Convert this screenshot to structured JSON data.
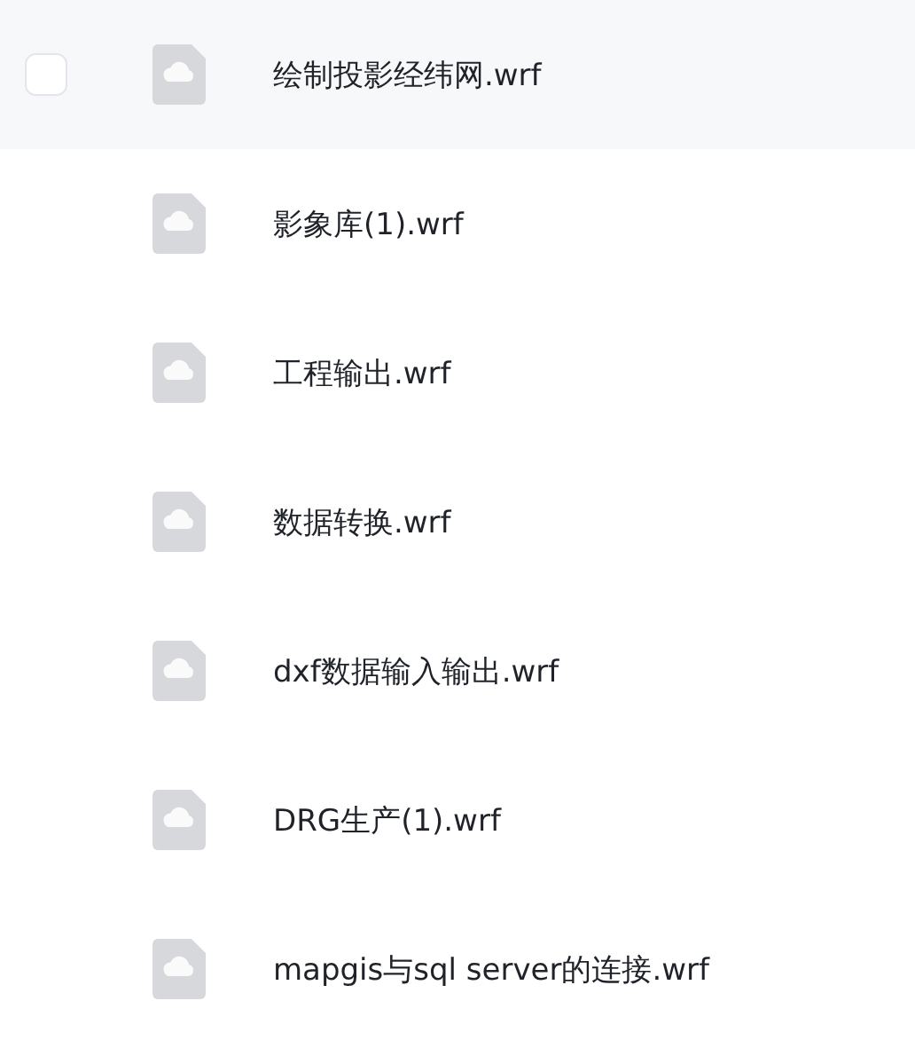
{
  "files": [
    {
      "name": "绘制投影经纬网.wrf",
      "hovered": true,
      "checked": false
    },
    {
      "name": "影象库(1).wrf",
      "hovered": false,
      "checked": false
    },
    {
      "name": "工程输出.wrf",
      "hovered": false,
      "checked": false
    },
    {
      "name": "数据转换.wrf",
      "hovered": false,
      "checked": false
    },
    {
      "name": "dxf数据输入输出.wrf",
      "hovered": false,
      "checked": false
    },
    {
      "name": "DRG生产(1).wrf",
      "hovered": false,
      "checked": false
    },
    {
      "name": "mapgis与sql server的连接.wrf",
      "hovered": false,
      "checked": false
    }
  ]
}
